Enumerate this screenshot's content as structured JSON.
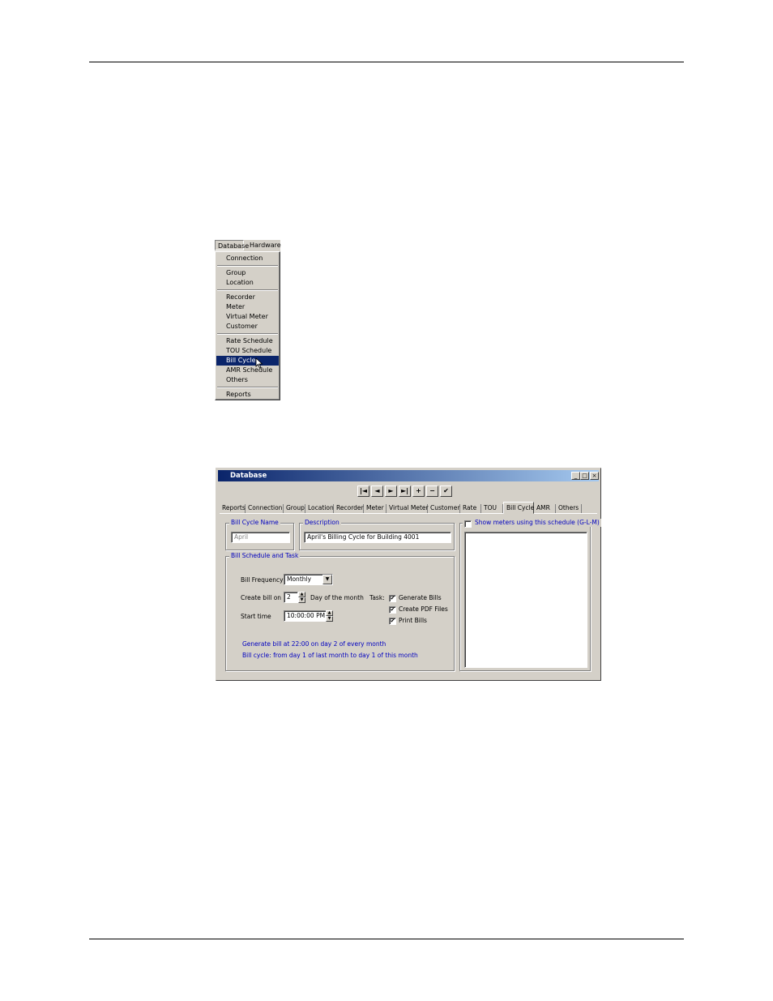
{
  "menu": {
    "menubar": [
      "Database",
      "Hardware"
    ],
    "items": [
      {
        "label": "Connection"
      },
      {
        "sep": true
      },
      {
        "label": "Group"
      },
      {
        "label": "Location"
      },
      {
        "sep": true
      },
      {
        "label": "Recorder"
      },
      {
        "label": "Meter"
      },
      {
        "label": "Virtual Meter"
      },
      {
        "label": "Customer"
      },
      {
        "sep": true
      },
      {
        "label": "Rate Schedule"
      },
      {
        "label": "TOU Schedule"
      },
      {
        "label": "Bill Cycle",
        "selected": true
      },
      {
        "label": "AMR Schedule"
      },
      {
        "label": "Others"
      },
      {
        "sep": true
      },
      {
        "label": "Reports"
      }
    ]
  },
  "window": {
    "title": "Database",
    "controls": {
      "minimize": "_",
      "maximize": "□",
      "close": "×"
    },
    "nav_buttons": [
      {
        "name": "first-record-button",
        "glyph": "|◄"
      },
      {
        "name": "prev-record-button",
        "glyph": "◄"
      },
      {
        "name": "next-record-button",
        "glyph": "►"
      },
      {
        "name": "last-record-button",
        "glyph": "►|"
      },
      {
        "name": "add-record-button",
        "glyph": "+"
      },
      {
        "name": "delete-record-button",
        "glyph": "−"
      },
      {
        "name": "save-record-button",
        "glyph": "✔"
      }
    ],
    "tabs": [
      "Reports",
      "Connection",
      "Group",
      "Location",
      "Recorder",
      "Meter",
      "Virtual Meter",
      "Customer",
      "Rate",
      "TOU",
      "Bill Cycle",
      "AMR",
      "Others"
    ],
    "active_tab": "Bill Cycle",
    "bill_cycle_name": {
      "label": "Bill Cycle Name",
      "value": "April"
    },
    "description": {
      "label": "Description",
      "value": "April's Billing Cycle for Building 4001"
    },
    "schedule": {
      "title": "Bill Schedule and Task",
      "frequency_label": "Bill Frequency",
      "frequency_value": "Monthly",
      "create_label": "Create bill on",
      "create_value": "2",
      "create_suffix": "Day of the month",
      "start_label": "Start time",
      "start_value": "10:00:00 PM",
      "task_label": "Task:",
      "tasks": [
        {
          "label": "Generate Bills",
          "checked": true
        },
        {
          "label": "Create PDF Files",
          "checked": true
        },
        {
          "label": "Print Bills",
          "checked": true
        }
      ],
      "info_line1": "Generate bill at 22:00 on day 2 of every month",
      "info_line2": "Bill cycle: from day 1 of last month to day 1 of this month"
    },
    "show_meters": {
      "label": "Show meters using this schedule (G-L-M)",
      "checked": false
    }
  }
}
